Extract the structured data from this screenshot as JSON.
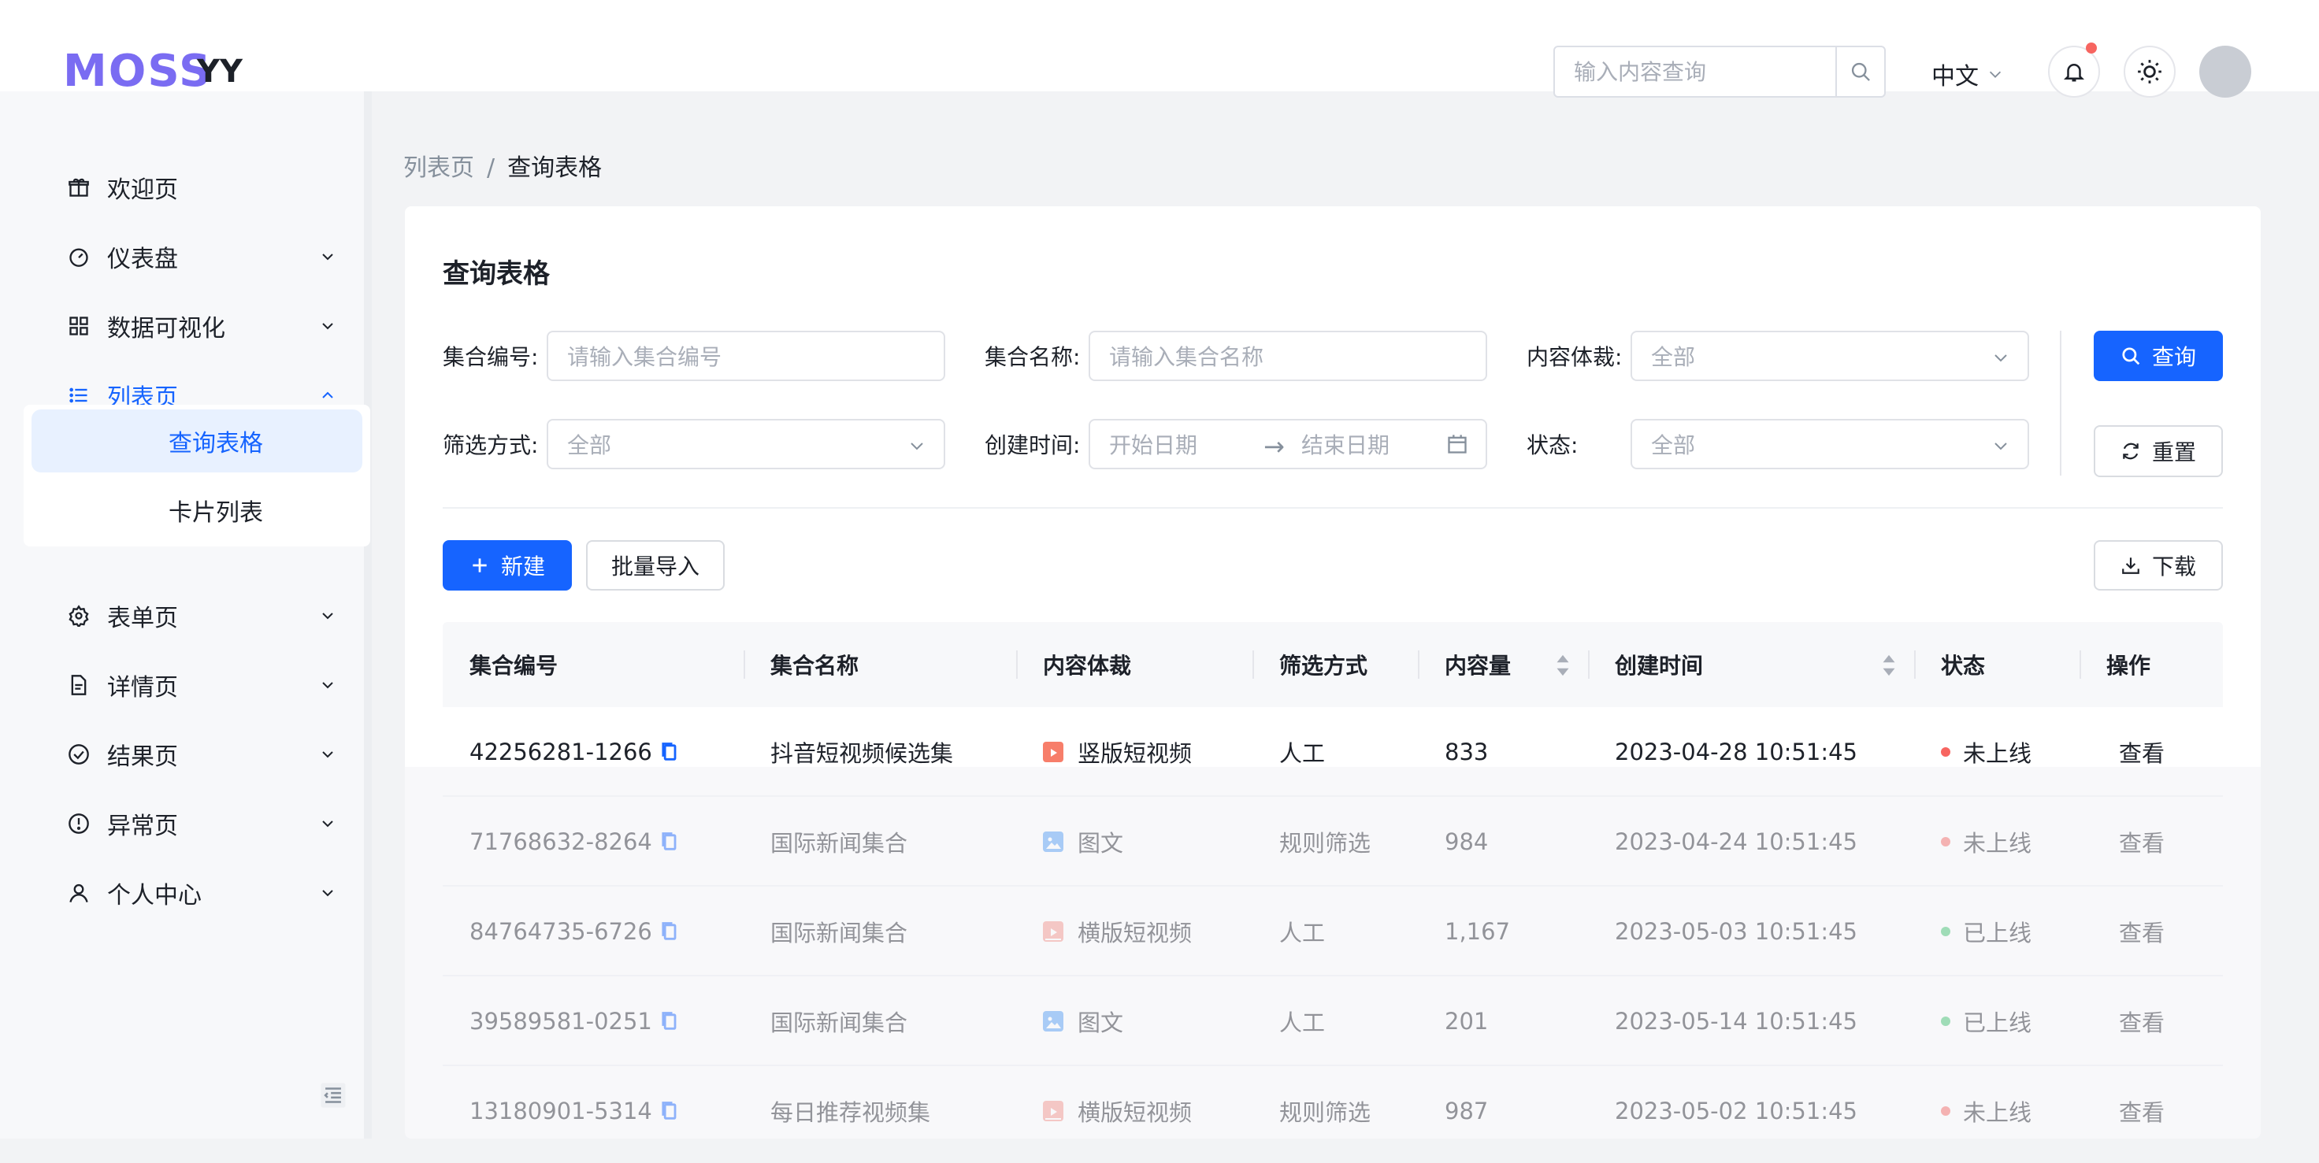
{
  "header": {
    "logo": "MOSS",
    "logo_sub": "YY",
    "search_placeholder": "输入内容查询",
    "language": "中文"
  },
  "sidebar": {
    "items": [
      {
        "label": "欢迎页",
        "icon": "gift-icon"
      },
      {
        "label": "仪表盘",
        "icon": "dashboard-icon"
      },
      {
        "label": "数据可视化",
        "icon": "grid-icon"
      },
      {
        "label": "列表页",
        "icon": "list-icon"
      },
      {
        "label": "表单页",
        "icon": "settings-icon"
      },
      {
        "label": "详情页",
        "icon": "file-icon"
      },
      {
        "label": "结果页",
        "icon": "check-circle-icon"
      },
      {
        "label": "异常页",
        "icon": "exclamation-circle-icon"
      },
      {
        "label": "个人中心",
        "icon": "user-icon"
      }
    ],
    "sub_items": [
      {
        "label": "查询表格"
      },
      {
        "label": "卡片列表"
      }
    ]
  },
  "breadcrumb": {
    "parent": "列表页",
    "separator": "/",
    "current": "查询表格"
  },
  "card": {
    "title": "查询表格"
  },
  "filters": {
    "id_label": "集合编号:",
    "id_placeholder": "请输入集合编号",
    "name_label": "集合名称:",
    "name_placeholder": "请输入集合名称",
    "type_label": "内容体裁:",
    "type_value": "全部",
    "method_label": "筛选方式:",
    "method_value": "全部",
    "time_label": "创建时间:",
    "start_placeholder": "开始日期",
    "end_placeholder": "结束日期",
    "status_label": "状态:",
    "status_value": "全部",
    "query_button": "查询",
    "reset_button": "重置"
  },
  "toolbar": {
    "new_button": "新建",
    "import_button": "批量导入",
    "download_button": "下载"
  },
  "table": {
    "columns": [
      "集合编号",
      "集合名称",
      "内容体裁",
      "筛选方式",
      "内容量",
      "创建时间",
      "状态",
      "操作"
    ],
    "rows": [
      {
        "id": "42256281-1266",
        "name": "抖音短视频候选集",
        "type": "竖版短视频",
        "type_icon": "vertical-video-icon",
        "method": "人工",
        "count": "833",
        "time": "2023-04-28 10:51:45",
        "status": "未上线",
        "status_color": "#f76560",
        "action": "查看"
      },
      {
        "id": "71768632-8264",
        "name": "国际新闻集合",
        "type": "图文",
        "type_icon": "image-icon",
        "method": "规则筛选",
        "count": "984",
        "time": "2023-04-24 10:51:45",
        "status": "未上线",
        "status_color": "#f76560",
        "action": "查看"
      },
      {
        "id": "84764735-6726",
        "name": "国际新闻集合",
        "type": "横版短视频",
        "type_icon": "horizontal-video-icon",
        "method": "人工",
        "count": "1,167",
        "time": "2023-05-03 10:51:45",
        "status": "已上线",
        "status_color": "#3ac26a",
        "action": "查看"
      },
      {
        "id": "39589581-0251",
        "name": "国际新闻集合",
        "type": "图文",
        "type_icon": "image-icon",
        "method": "人工",
        "count": "201",
        "time": "2023-05-14 10:51:45",
        "status": "已上线",
        "status_color": "#3ac26a",
        "action": "查看"
      },
      {
        "id": "13180901-5314",
        "name": "每日推荐视频集",
        "type": "横版短视频",
        "type_icon": "horizontal-video-icon",
        "method": "规则筛选",
        "count": "987",
        "time": "2023-05-02 10:51:45",
        "status": "未上线",
        "status_color": "#f76560",
        "action": "查看"
      }
    ]
  },
  "colors": {
    "primary": "#1664ff",
    "logo": "#7a6cf2",
    "offline": "#f76560",
    "online": "#3ac26a"
  }
}
